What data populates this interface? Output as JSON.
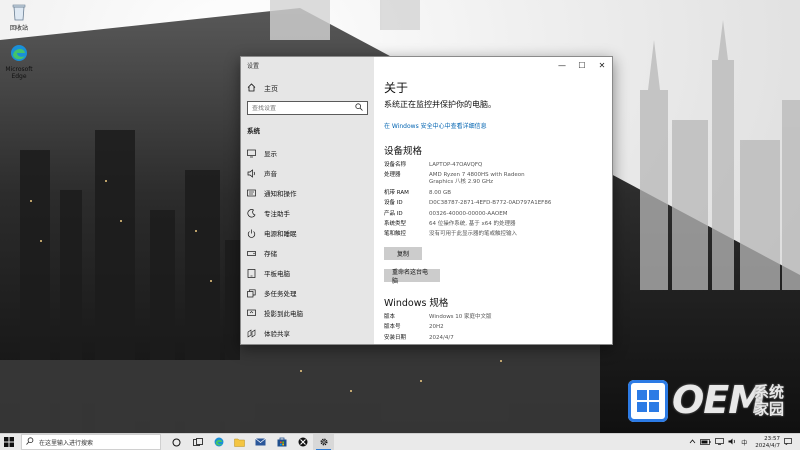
{
  "desktop": {
    "icons": [
      {
        "label": "回收站",
        "icon": "recycle-bin-icon"
      },
      {
        "label": "Microsoft Edge",
        "icon": "edge-icon"
      }
    ],
    "watermark": {
      "brand": "OEM",
      "sub": "系统家园"
    }
  },
  "window": {
    "title": "设置",
    "caption": {
      "minimize": "—",
      "maximize": "☐",
      "close": "✕"
    },
    "sidebar": {
      "home_label": "主页",
      "search_placeholder": "查找设置",
      "section": "系统",
      "items": [
        {
          "label": "显示",
          "icon": "display-icon"
        },
        {
          "label": "声音",
          "icon": "sound-icon"
        },
        {
          "label": "通知和操作",
          "icon": "notification-icon"
        },
        {
          "label": "专注助手",
          "icon": "focus-assist-icon"
        },
        {
          "label": "电源和睡眠",
          "icon": "power-icon"
        },
        {
          "label": "存储",
          "icon": "storage-icon"
        },
        {
          "label": "平板电脑",
          "icon": "tablet-icon"
        },
        {
          "label": "多任务处理",
          "icon": "multitasking-icon"
        },
        {
          "label": "投影到此电脑",
          "icon": "project-icon"
        },
        {
          "label": "体验共享",
          "icon": "shared-experiences-icon"
        }
      ]
    },
    "content": {
      "title": "关于",
      "subtitle": "系统正在监控并保护你的电脑。",
      "security_link": "在 Windows 安全中心中查看详细信息",
      "device_spec_heading": "设备规格",
      "device_specs": [
        {
          "key": "设备名称",
          "value": "LAPTOP-47OAVQFQ"
        },
        {
          "key": "处理器",
          "value": "AMD Ryzen 7 4800HS with Radeon Graphics 八核 2.90 GHz"
        },
        {
          "key": "机带 RAM",
          "value": "8.00 GB"
        },
        {
          "key": "设备 ID",
          "value": "D0C38787-2871-4EFD-B772-0AD797A1EF86"
        },
        {
          "key": "产品 ID",
          "value": "00326-40000-00000-AAOEM"
        },
        {
          "key": "系统类型",
          "value": "64 位操作系统, 基于 x64 的处理器"
        },
        {
          "key": "笔和触控",
          "value": "没有可用于此显示器的笔或触控输入"
        }
      ],
      "copy_button": "复制",
      "rename_button": "重命名这台电脑",
      "windows_spec_heading": "Windows 规格",
      "windows_specs": [
        {
          "key": "版本",
          "value": "Windows 10 家庭中文版"
        },
        {
          "key": "版本号",
          "value": "20H2"
        },
        {
          "key": "安装日期",
          "value": "2024/4/7"
        }
      ]
    }
  },
  "taskbar": {
    "search_placeholder": "在这里输入进行搜索",
    "apps": [
      {
        "name": "cortana",
        "icon": "cortana-circle-icon",
        "active": false
      },
      {
        "name": "task-view",
        "icon": "task-view-icon",
        "active": false
      },
      {
        "name": "edge",
        "icon": "edge-icon",
        "active": false
      },
      {
        "name": "file-explorer",
        "icon": "folder-icon",
        "active": false
      },
      {
        "name": "mail",
        "icon": "mail-icon",
        "active": false
      },
      {
        "name": "store",
        "icon": "store-icon",
        "active": false
      },
      {
        "name": "xbox",
        "icon": "xbox-icon",
        "active": false
      },
      {
        "name": "settings",
        "icon": "gear-icon",
        "active": true
      }
    ],
    "clock": {
      "time": "23:57",
      "date": "2024/4/7"
    },
    "input_method": "中",
    "accent": "#2a7ad6"
  }
}
